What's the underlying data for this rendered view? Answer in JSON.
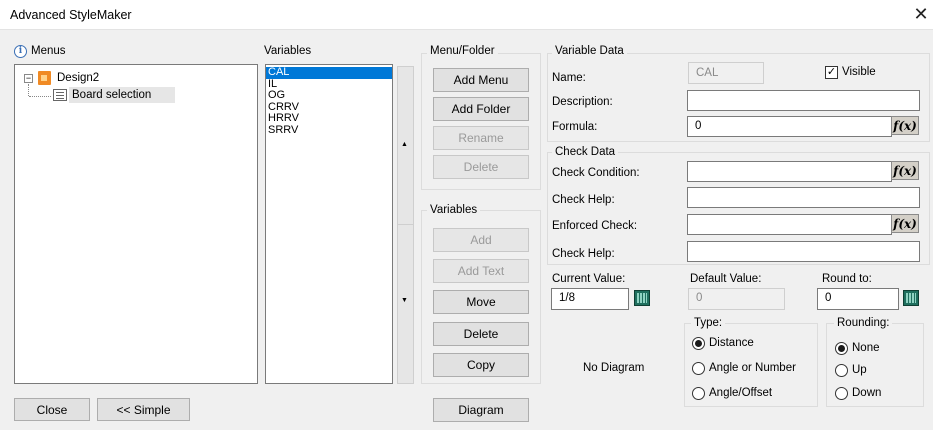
{
  "window": {
    "title": "Advanced StyleMaker",
    "close_glyph": "✕"
  },
  "menus": {
    "label": "Menus",
    "tree": {
      "root": "Design2",
      "child": "Board selection",
      "expander": "⊟"
    }
  },
  "variables_panel": {
    "label": "Variables",
    "items": [
      "CAL",
      "IL",
      "OG",
      "CRRV",
      "HRRV",
      "SRRV"
    ],
    "selected": "CAL",
    "scroll_up": "▲",
    "scroll_down": "▼"
  },
  "menu_folder": {
    "label": "Menu/Folder",
    "add_menu": "Add Menu",
    "add_folder": "Add Folder",
    "rename": "Rename",
    "delete": "Delete"
  },
  "variables_group": {
    "label": "Variables",
    "add": "Add",
    "add_text": "Add Text",
    "move": "Move",
    "delete": "Delete",
    "copy": "Copy"
  },
  "variable_data": {
    "label": "Variable Data",
    "name_label": "Name:",
    "name_value": "CAL",
    "visible_label": "Visible",
    "visible_checked": true,
    "description_label": "Description:",
    "description_value": "",
    "formula_label": "Formula:",
    "formula_value": "0",
    "fx_label": "f(x)"
  },
  "check_data": {
    "label": "Check Data",
    "check_condition_label": "Check Condition:",
    "check_help_label": "Check Help:",
    "enforced_check_label": "Enforced Check:",
    "check_help2_label": "Check Help:"
  },
  "values": {
    "current_label": "Current Value:",
    "current_value": "1/8",
    "default_label": "Default Value:",
    "default_value": "0",
    "round_label": "Round to:",
    "round_value": "0"
  },
  "type_group": {
    "label": "Type:",
    "options": [
      "Distance",
      "Angle or Number",
      "Angle/Offset"
    ],
    "selected": "Distance"
  },
  "rounding_group": {
    "label": "Rounding:",
    "options": [
      "None",
      "Up",
      "Down"
    ],
    "selected": "None"
  },
  "diagram": {
    "placeholder": "No Diagram",
    "button": "Diagram"
  },
  "footer": {
    "close": "Close",
    "simple": "<< Simple"
  }
}
